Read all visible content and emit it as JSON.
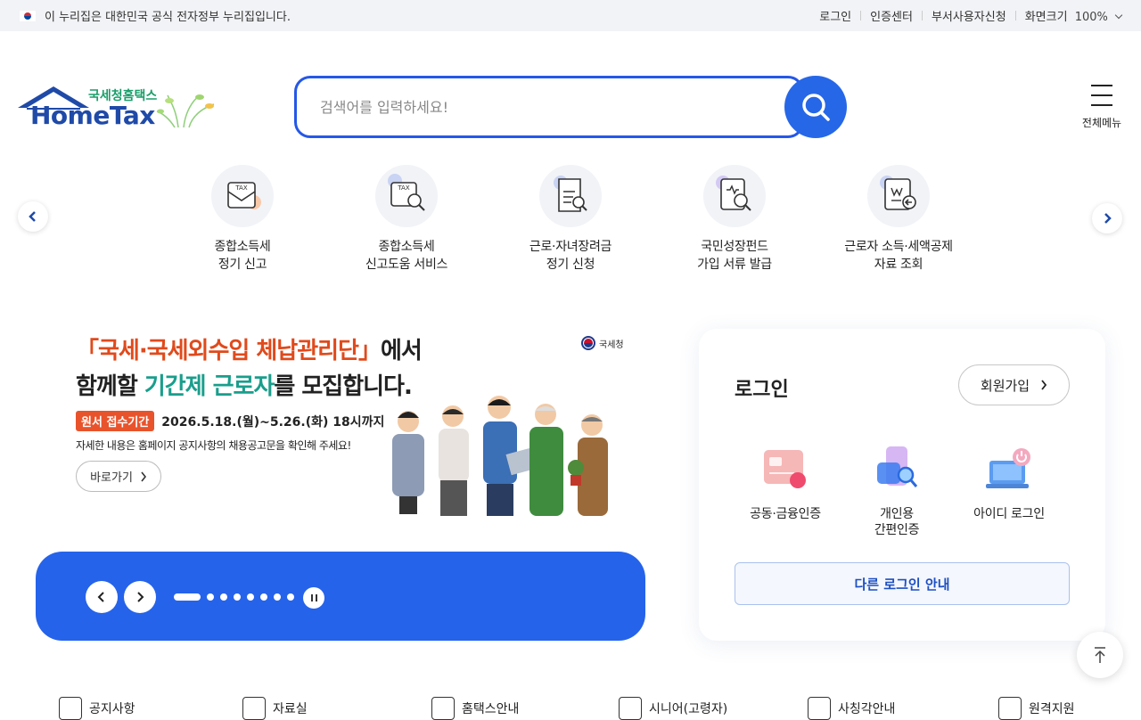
{
  "gov_banner": {
    "text": "이 누리집은 대한민국 공식 전자정부 누리집입니다.",
    "links": [
      "로그인",
      "인증센터",
      "부서사용자신청"
    ],
    "zoom_label": "화면크기",
    "zoom_value": "100%"
  },
  "logo": {
    "kr": "국세청홈택스",
    "en": "HomeTax"
  },
  "search": {
    "placeholder": "검색어를 입력하세요!"
  },
  "all_menu": {
    "label": "전체메뉴"
  },
  "services": [
    {
      "line1": "종합소득세",
      "line2": "정기 신고"
    },
    {
      "line1": "종합소득세",
      "line2": "신고도움 서비스"
    },
    {
      "line1": "근로·자녀장려금",
      "line2": "정기 신청"
    },
    {
      "line1": "국민성장펀드",
      "line2": "가입 서류 발급"
    },
    {
      "line1": "근로자 소득·세액공제",
      "line2": "자료 조회"
    }
  ],
  "banner": {
    "title1_pre": "「국세·국세외수입 체납관리단」",
    "title1_post": "에서",
    "title2_pre": "함께할 ",
    "title2_hl": "기간제 근로자",
    "title2_post": "를 모집합니다.",
    "badge": "원서 접수기간",
    "period": "2026.5.18.(월)~5.26.(화) 18시까지",
    "desc": "자세한 내용은 홈페이지 공지사항의 채용공고문을 확인해 주세요!",
    "go_label": "바로가기",
    "agency": "국세청"
  },
  "slider": {
    "total_dots": 8,
    "active_index": 0
  },
  "login": {
    "title": "로그인",
    "join_label": "회원가입",
    "options": [
      {
        "line1": "공동·금융인증",
        "line2": ""
      },
      {
        "line1": "개인용",
        "line2": "간편인증"
      },
      {
        "line1": "아이디 로그인",
        "line2": ""
      }
    ],
    "other_label": "다른 로그인 안내"
  },
  "quick_links": [
    "공지사항",
    "자료실",
    "홈택스안내",
    "시니어(고령자)",
    "사칭각안내",
    "원격지원"
  ],
  "colors": {
    "primary": "#2563eb",
    "brand_green": "#1a9e6a",
    "brand_blue": "#1f4aa8"
  }
}
